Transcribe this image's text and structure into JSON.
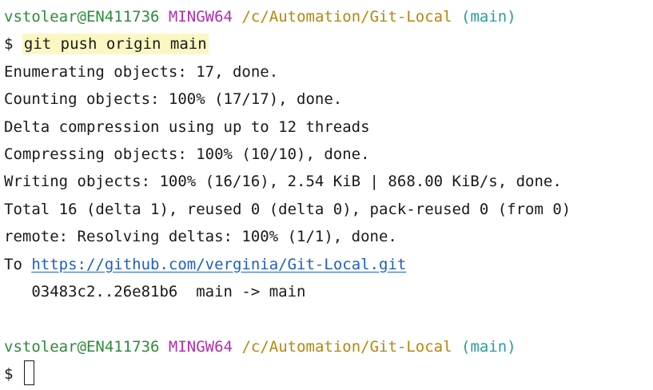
{
  "prompt1": {
    "user": "vstolear@EN411736",
    "system": "MINGW64",
    "path": "/c/Automation/Git-Local",
    "branch": "(main)"
  },
  "command": {
    "symbol": "$",
    "text": "git push origin main"
  },
  "output": [
    "Enumerating objects: 17, done.",
    "Counting objects: 100% (17/17), done.",
    "Delta compression using up to 12 threads",
    "Compressing objects: 100% (10/10), done.",
    "Writing objects: 100% (16/16), 2.54 KiB | 868.00 KiB/s, done.",
    "Total 16 (delta 1), reused 0 (delta 0), pack-reused 0 (from 0)",
    "remote: Resolving deltas: 100% (1/1), done."
  ],
  "remote_line": {
    "prefix": "To ",
    "url": "https://github.com/verginia/Git-Local.git"
  },
  "ref_update": "   03483c2..26e81b6  main -> main",
  "prompt2": {
    "user": "vstolear@EN411736",
    "system": "MINGW64",
    "path": "/c/Automation/Git-Local",
    "branch": "(main)"
  },
  "input_prompt": {
    "symbol": "$"
  },
  "colors": {
    "user": "#2e8b3a",
    "system": "#b030b0",
    "path": "#b8860b",
    "branch": "#2a9d9d",
    "link": "#1f5fbf",
    "command_highlight": "#fbf7c2"
  }
}
